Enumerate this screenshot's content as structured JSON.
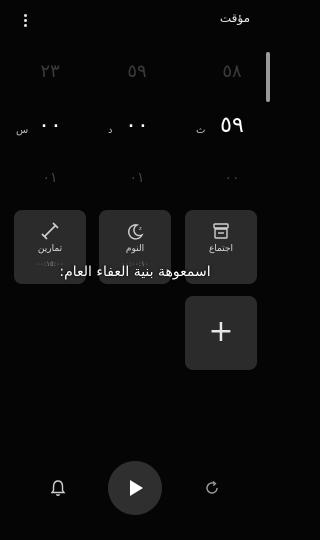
{
  "app": {
    "title": "مؤقت"
  },
  "picker": {
    "hours": {
      "prev": "٢٣",
      "current": "٠٠",
      "next": "٠١",
      "unit": "س"
    },
    "minutes": {
      "prev": "٥٩",
      "current": "٠٠",
      "next": "٠١",
      "unit": "د"
    },
    "seconds": {
      "prev": "٥٨",
      "current": "٥٩",
      "next": "٠٠",
      "unit": "ث"
    }
  },
  "presets": [
    {
      "label": "اجتماع",
      "time": "",
      "icon": "meeting-icon"
    },
    {
      "label": "النوم",
      "time": "٠٠:٠٠:١٠",
      "icon": "moon-icon"
    },
    {
      "label": "تمارين",
      "time": "٠٠:١٥:٠٠",
      "icon": "exercise-icon"
    }
  ],
  "add_preset": {
    "label": "+"
  },
  "overlay_text": "اسمعوهة بنية العفاء العام:",
  "controls": {
    "bell_icon": "bell-icon",
    "play_icon": "play-icon",
    "restart_icon": "restart-icon"
  },
  "colors": {
    "background": "#050505",
    "tile": "#2b2b2b",
    "play_button": "#2f2f2f"
  }
}
